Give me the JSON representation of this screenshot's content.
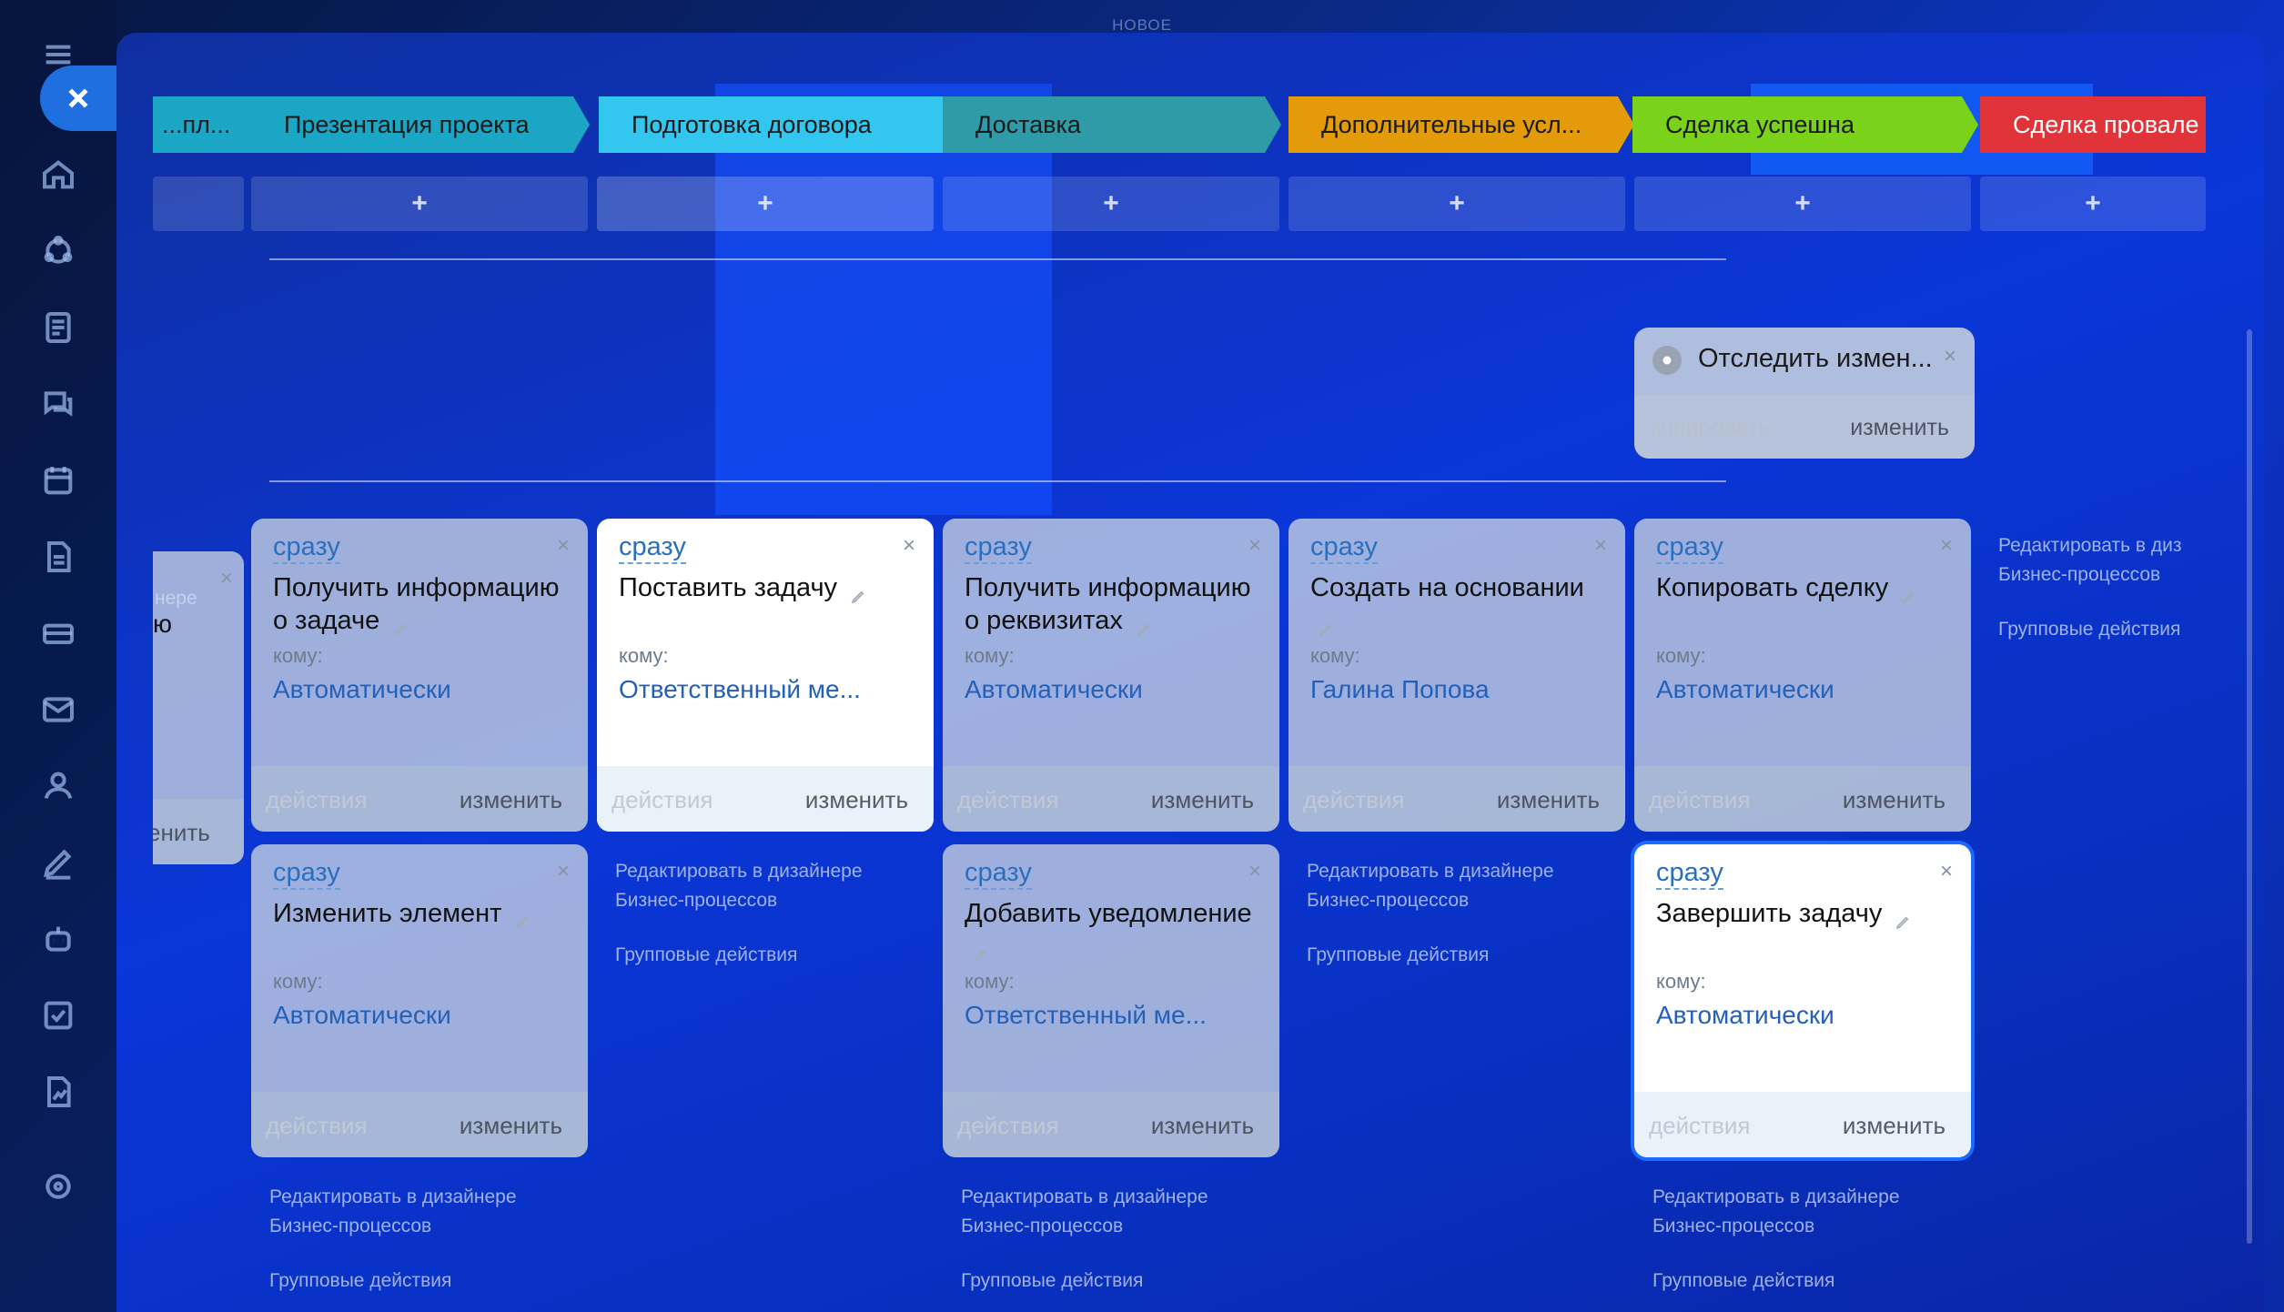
{
  "top_label": "НОВОЕ",
  "stages": [
    {
      "label": "...пл...",
      "color": "#1aa6c4"
    },
    {
      "label": "Презентация проекта",
      "color": "#1aa6c4"
    },
    {
      "label": "Подготовка договора",
      "color": "#33c7f0"
    },
    {
      "label": "Доставка",
      "color": "#2f9aa8"
    },
    {
      "label": "Дополнительные усл...",
      "color": "#e39b0a"
    },
    {
      "label": "Сделка успешна",
      "color": "#7ad31a"
    },
    {
      "label": "Сделка провале",
      "color": "#e0343a"
    }
  ],
  "add_symbol": "+",
  "tracker": {
    "title": "Отследить измен...",
    "copy": "копировать",
    "edit": "изменить"
  },
  "partial": {
    "fragment": "ю",
    "edit_fragment": "енить",
    "link_fragment": "нере"
  },
  "card_common": {
    "when": "сразу",
    "to_label": "кому:",
    "actions": "действия",
    "edit": "изменить",
    "close": "×"
  },
  "cards_row1": [
    {
      "title": "Получить информацию о задаче",
      "to": "Автоматически"
    },
    {
      "title": "Поставить задачу",
      "to": "Ответственный ме..."
    },
    {
      "title": "Получить информацию о реквизитах",
      "to": "Автоматически"
    },
    {
      "title": "Создать на основании",
      "to": "Галина Попова"
    },
    {
      "title": "Копировать сделку",
      "to": "Автоматически"
    }
  ],
  "cards_row2": [
    {
      "title": "Изменить элемент",
      "to": "Автоматически"
    },
    {
      "title": "Добавить уведомление",
      "to": "Ответственный ме..."
    },
    {
      "title": "Завершить задачу",
      "to": "Автоматически"
    }
  ],
  "links": {
    "designer_full": "Редактировать в дизайнере Бизнес-процессов",
    "designer_cut": "Редактировать в диз Бизнес-процессов",
    "group": "Групповые действия"
  }
}
